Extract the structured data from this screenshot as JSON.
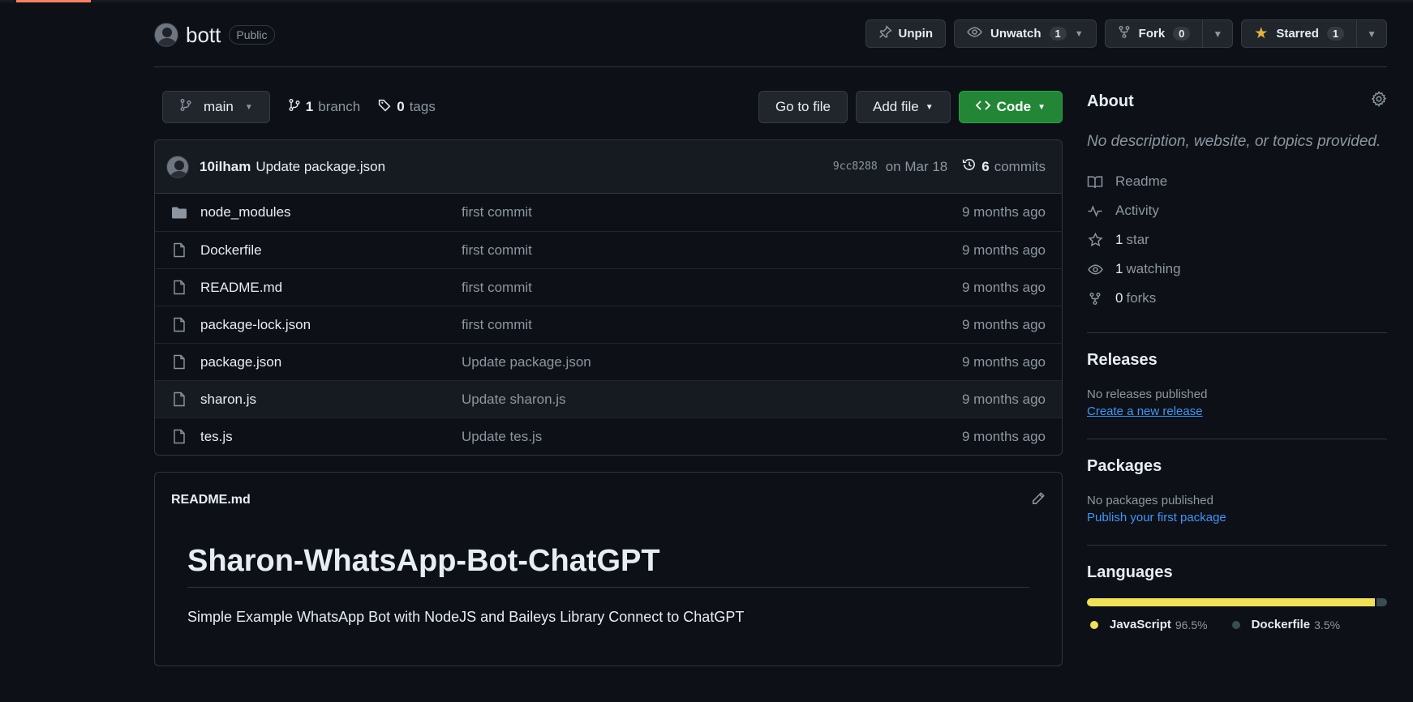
{
  "repo": {
    "name": "bott",
    "visibility": "Public"
  },
  "header_actions": {
    "unpin": "Unpin",
    "unwatch": "Unwatch",
    "watch_count": "1",
    "fork": "Fork",
    "fork_count": "0",
    "starred": "Starred",
    "star_count": "1"
  },
  "toolbar": {
    "branch": "main",
    "branch_count": "1",
    "branch_label": "branch",
    "tag_count": "0",
    "tag_label": "tags",
    "go_to_file": "Go to file",
    "add_file": "Add file",
    "code": "Code"
  },
  "latest_commit": {
    "author": "10ilham",
    "message": "Update package.json",
    "sha": "9cc8288",
    "date": "on Mar 18",
    "commit_count": "6",
    "commit_label": "commits"
  },
  "files": [
    {
      "name": "node_modules",
      "type": "folder",
      "message": "first commit",
      "age": "9 months ago"
    },
    {
      "name": "Dockerfile",
      "type": "file",
      "message": "first commit",
      "age": "9 months ago"
    },
    {
      "name": "README.md",
      "type": "file",
      "message": "first commit",
      "age": "9 months ago"
    },
    {
      "name": "package-lock.json",
      "type": "file",
      "message": "first commit",
      "age": "9 months ago"
    },
    {
      "name": "package.json",
      "type": "file",
      "message": "Update package.json",
      "age": "9 months ago"
    },
    {
      "name": "sharon.js",
      "type": "file",
      "message": "Update sharon.js",
      "age": "9 months ago"
    },
    {
      "name": "tes.js",
      "type": "file",
      "message": "Update tes.js",
      "age": "9 months ago"
    }
  ],
  "readme": {
    "filename": "README.md",
    "heading": "Sharon-WhatsApp-Bot-ChatGPT",
    "description": "Simple Example WhatsApp Bot with NodeJS and Baileys Library Connect to ChatGPT"
  },
  "about": {
    "title": "About",
    "description": "No description, website, or topics provided.",
    "readme": "Readme",
    "activity": "Activity",
    "stars_count": "1",
    "stars_label": "star",
    "watching_count": "1",
    "watching_label": "watching",
    "forks_count": "0",
    "forks_label": "forks"
  },
  "releases": {
    "title": "Releases",
    "empty": "No releases published",
    "link": "Create a new release"
  },
  "packages": {
    "title": "Packages",
    "empty": "No packages published",
    "link": "Publish your first package"
  },
  "languages": {
    "title": "Languages",
    "items": [
      {
        "name": "JavaScript",
        "percent": "96.5%",
        "value": 96.5,
        "color": "#f1e05a"
      },
      {
        "name": "Dockerfile",
        "percent": "3.5%",
        "value": 3.5,
        "color": "#384d54"
      }
    ]
  },
  "colors": {
    "background": "#0d1117",
    "accent_green": "#238636",
    "link_blue": "#4493f8",
    "star_yellow": "#e3b341"
  }
}
